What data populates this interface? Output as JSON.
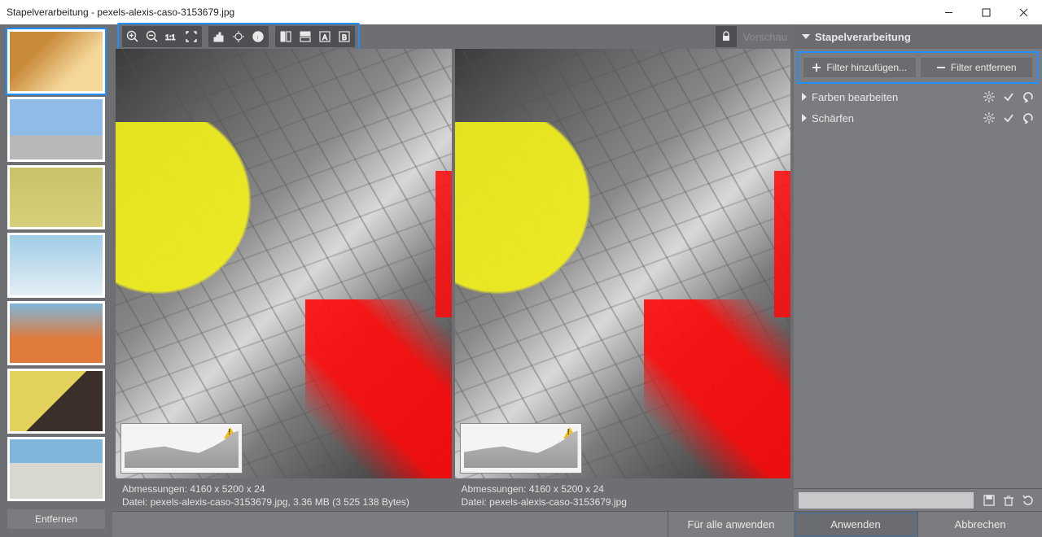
{
  "window": {
    "title": "Stapelverarbeitung - pexels-alexis-caso-3153679.jpg"
  },
  "thumbs": {
    "remove_label": "Entfernen"
  },
  "toolbar": {
    "preview_label": "Vorschau"
  },
  "preview": {
    "left": {
      "dimensions": "Abmessungen: 4160 x 5200 x 24",
      "file": "Datei: pexels-alexis-caso-3153679.jpg, 3.36 MB (3 525 138 Bytes)"
    },
    "right": {
      "dimensions": "Abmessungen: 4160 x 5200 x 24",
      "file": "Datei: pexels-alexis-caso-3153679.jpg"
    }
  },
  "rightpanel": {
    "header": "Stapelverarbeitung",
    "add_filter": "Filter hinzufügen...",
    "remove_filter": "Filter entfernen",
    "filters": {
      "0": {
        "label": "Farben bearbeiten"
      },
      "1": {
        "label": "Schärfen"
      }
    }
  },
  "buttons": {
    "apply_all": "Für alle anwenden",
    "apply": "Anwenden",
    "cancel": "Abbrechen"
  }
}
